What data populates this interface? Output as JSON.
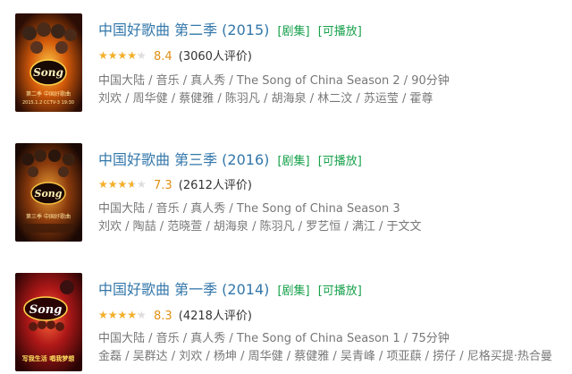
{
  "items": [
    {
      "title": "中国好歌曲 第二季 (2015)",
      "tag_series": "[剧集]",
      "tag_playable": "[可播放]",
      "rating_fraction": 0.84,
      "score": "8.4",
      "count": "(3060人评价)",
      "meta": "中国大陆 / 音乐 / 真人秀 / The Song of China Season 2 / 90分钟",
      "cast": "刘欢 / 周华健 / 蔡健雅 / 陈羽凡 / 胡海泉 / 林二汶 / 苏运莹 / 霍尊",
      "poster_text": [
        "Song",
        "第二季 中国好歌曲",
        "2015.1.2 CCTV-3 19:30"
      ]
    },
    {
      "title": "中国好歌曲 第三季 (2016)",
      "tag_series": "[剧集]",
      "tag_playable": "[可播放]",
      "rating_fraction": 0.73,
      "score": "7.3",
      "count": "(2612人评价)",
      "meta": "中国大陆 / 音乐 / 真人秀 / The Song of China Season 3",
      "cast": "刘欢 / 陶喆 / 范晓萱 / 胡海泉 / 陈羽凡 / 罗艺恒 / 满江 / 于文文",
      "poster_text": [
        "Song",
        "第三季 中国好歌曲"
      ]
    },
    {
      "title": "中国好歌曲 第一季 (2014)",
      "tag_series": "[剧集]",
      "tag_playable": "[可播放]",
      "rating_fraction": 0.83,
      "score": "8.3",
      "count": "(4218人评价)",
      "meta": "中国大陆 / 音乐 / 真人秀 / The Song of China Season 1 / 75分钟",
      "cast": "金磊 / 吴群达 / 刘欢 / 杨坤 / 周华健 / 蔡健雅 / 吴青峰 / 项亚蕻 / 捞仔 / 尼格买提·热合曼",
      "poster_text": [
        "Song",
        "写我生活 唱我梦想"
      ]
    }
  ]
}
